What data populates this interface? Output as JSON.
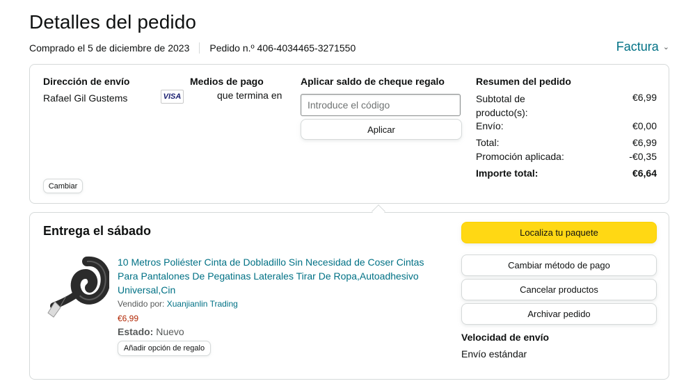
{
  "header": {
    "title": "Detalles del pedido",
    "purchase_date": "Comprado el 5 de diciembre de 2023",
    "order_number": "Pedido n.º 406-4034465-3271550",
    "invoice_label": "Factura"
  },
  "shipping": {
    "title": "Dirección de envío",
    "name": "Rafael Gil Gustems",
    "change_label": "Cambiar"
  },
  "payment": {
    "title": "Medios de pago",
    "card_brand": "VISA",
    "card_text": "que termina en"
  },
  "gift_card": {
    "title": "Aplicar saldo de cheque regalo",
    "placeholder": "Introduce el código",
    "apply_label": "Aplicar"
  },
  "summary": {
    "title": "Resumen del pedido",
    "rows": [
      {
        "label": "Subtotal de producto(s):",
        "value": "€6,99"
      },
      {
        "label": "Envío:",
        "value": "€0,00"
      },
      {
        "label": "Total:",
        "value": "€6,99"
      },
      {
        "label": "Promoción aplicada:",
        "value": "-€0,35"
      },
      {
        "label": "Importe total:",
        "value": "€6,64"
      }
    ]
  },
  "delivery": {
    "title": "Entrega el sábado",
    "product": {
      "title": "10 Metros Poliéster Cinta de Dobladillo Sin Necesidad de Coser Cintas Para Pantalones De Pegatinas Laterales Tirar De Ropa,Autoadhesivo Universal,Cin",
      "seller_label": "Vendido por:",
      "seller_name": "Xuanjianlin Trading",
      "price": "€6,99",
      "status_label": "Estado:",
      "status_value": "Nuevo",
      "gift_label": "Añadir opción de regalo"
    },
    "actions": {
      "track": "Localiza tu paquete",
      "change_payment": "Cambiar método de pago",
      "cancel": "Cancelar productos",
      "archive": "Archivar pedido"
    },
    "speed_title": "Velocidad de envío",
    "speed_value": "Envío estándar"
  },
  "colors": {
    "link": "#007185",
    "price": "#b12704",
    "primary_button": "#ffd814",
    "border": "#d5d9d9"
  }
}
